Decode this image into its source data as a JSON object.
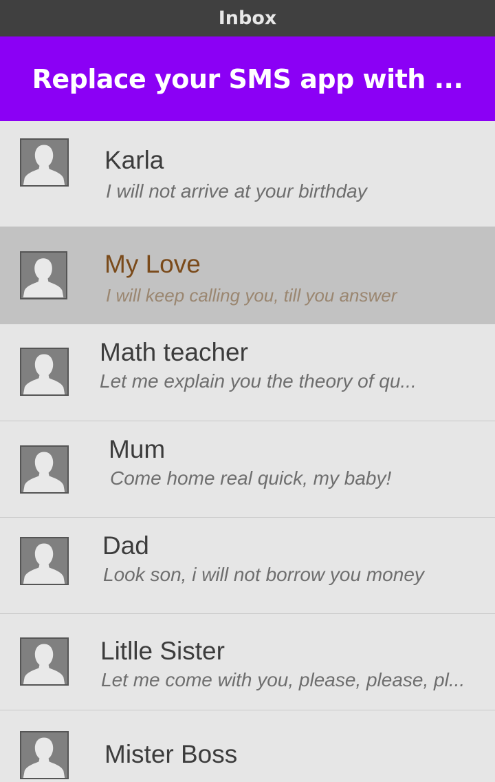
{
  "titlebar": {
    "title": "Inbox"
  },
  "banner": {
    "text": "Replace your SMS app with ..."
  },
  "conversations": [
    {
      "name": "Karla",
      "message": "I will not arrive at your birthday",
      "avatar_icon": "default-person-icon",
      "selected": false
    },
    {
      "name": "My Love",
      "message": "I will keep calling you, till you answer",
      "avatar_icon": "default-person-icon",
      "selected": true
    },
    {
      "name": "Math teacher",
      "message": "Let me explain you the theory of qu...",
      "avatar_icon": "default-person-icon",
      "selected": false
    },
    {
      "name": "Mum",
      "message": "Come home real quick, my baby!",
      "avatar_icon": "default-person-icon",
      "selected": false
    },
    {
      "name": "Dad",
      "message": "Look son, i will not borrow you money",
      "avatar_icon": "default-person-icon",
      "selected": false
    },
    {
      "name": "Litlle Sister",
      "message": "Let me come with you, please, please, pl...",
      "avatar_icon": "default-person-icon",
      "selected": false
    },
    {
      "name": "Mister Boss",
      "message": "",
      "avatar_icon": "default-person-icon",
      "selected": false
    }
  ],
  "colors": {
    "titlebar_bg": "#404040",
    "banner_bg": "#8b00f5",
    "list_bg": "#e6e6e6",
    "selected_bg": "#c2c2c2",
    "selected_name": "#7a4a1a"
  }
}
